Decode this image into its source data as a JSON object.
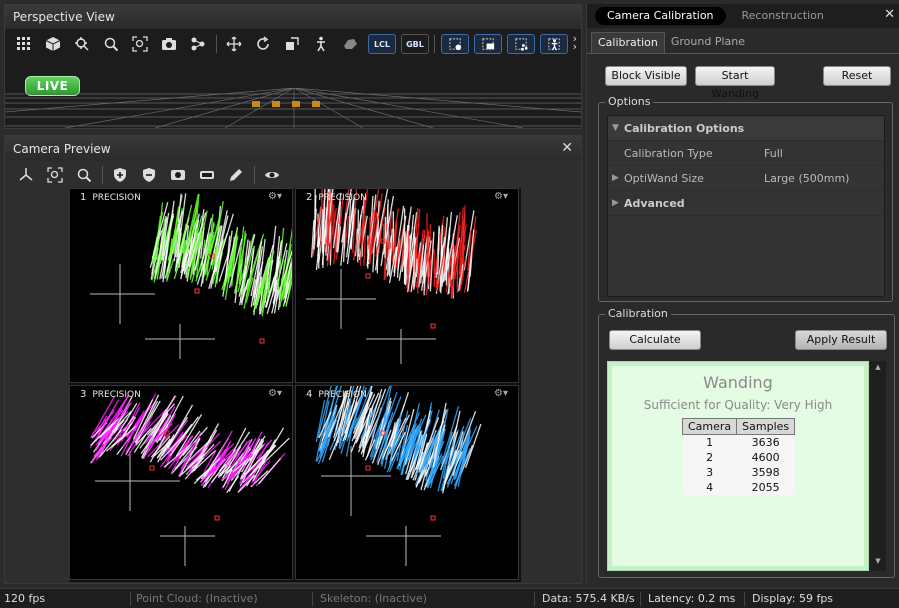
{
  "perspective": {
    "title": "Perspective View",
    "lcl_label": "LCL",
    "gbl_label": "GBL",
    "live_label": "LIVE"
  },
  "preview": {
    "title": "Camera Preview",
    "cameras": [
      {
        "num": "1",
        "mode": "PRECISION",
        "color": "#66ff33"
      },
      {
        "num": "2",
        "mode": "PRECISION",
        "color": "#ff2222"
      },
      {
        "num": "3",
        "mode": "PRECISION",
        "color": "#ff22ff"
      },
      {
        "num": "4",
        "mode": "PRECISION",
        "color": "#33aaff"
      }
    ]
  },
  "right": {
    "tabs": [
      "Camera Calibration",
      "Reconstruction"
    ],
    "subtabs": [
      "Calibration",
      "Ground Plane"
    ],
    "buttons": {
      "block_visible": "Block Visible",
      "start_wanding": "Start Wanding",
      "reset": "Reset",
      "calculate": "Calculate",
      "apply_result": "Apply Result"
    },
    "options": {
      "legend": "Options",
      "header": "Calibration Options",
      "rows": [
        {
          "label": "Calibration Type",
          "value": "Full"
        },
        {
          "label": "OptiWand Size",
          "value": "Large (500mm)"
        }
      ],
      "advanced": "Advanced"
    },
    "calibration": {
      "legend": "Calibration",
      "result_title": "Wanding",
      "result_sub": "Sufficient for Quality: Very High",
      "columns": [
        "Camera",
        "Samples"
      ],
      "rows": [
        {
          "camera": "1",
          "samples": "3636"
        },
        {
          "camera": "2",
          "samples": "4600"
        },
        {
          "camera": "3",
          "samples": "3598"
        },
        {
          "camera": "4",
          "samples": "2055"
        }
      ]
    }
  },
  "status": {
    "fps": "120 fps",
    "point_cloud": "Point Cloud: (Inactive)",
    "skeleton": "Skeleton: (Inactive)",
    "data": "Data: 575.4 KB/s",
    "latency": "Latency: 0.2 ms",
    "display": "Display: 59 fps"
  }
}
